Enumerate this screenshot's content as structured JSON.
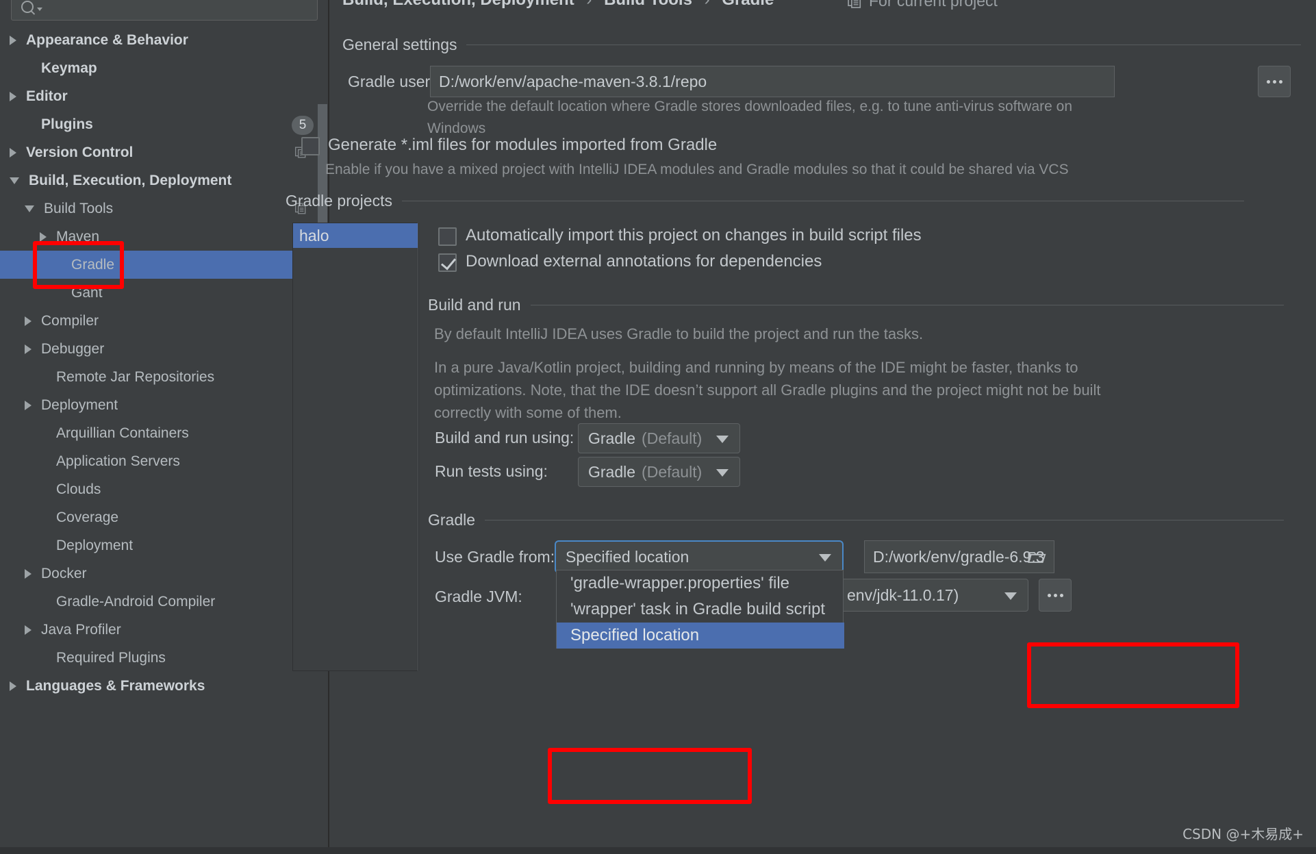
{
  "sidebar": {
    "search": {
      "placeholder": "",
      "icon": "search-icon"
    },
    "items": [
      {
        "label": "Appearance & Behavior",
        "arrow": "right",
        "bold": true,
        "indent": 0,
        "copy": false,
        "badge": null,
        "selected": false
      },
      {
        "label": "Keymap",
        "arrow": "none",
        "bold": true,
        "indent": 1,
        "copy": false,
        "badge": null,
        "selected": false
      },
      {
        "label": "Editor",
        "arrow": "right",
        "bold": true,
        "indent": 0,
        "copy": false,
        "badge": null,
        "selected": false
      },
      {
        "label": "Plugins",
        "arrow": "none",
        "bold": true,
        "indent": 1,
        "copy": false,
        "badge": "5",
        "selected": false
      },
      {
        "label": "Version Control",
        "arrow": "right",
        "bold": true,
        "indent": 0,
        "copy": true,
        "badge": null,
        "selected": false
      },
      {
        "label": "Build, Execution, Deployment",
        "arrow": "down",
        "bold": true,
        "indent": 0,
        "copy": false,
        "badge": null,
        "selected": false
      },
      {
        "label": "Build Tools",
        "arrow": "down",
        "bold": false,
        "indent": 1,
        "copy": true,
        "badge": null,
        "selected": false
      },
      {
        "label": "Maven",
        "arrow": "right",
        "bold": false,
        "indent": 2,
        "copy": true,
        "badge": null,
        "selected": false
      },
      {
        "label": "Gradle",
        "arrow": "none",
        "bold": false,
        "indent": 3,
        "copy": true,
        "badge": null,
        "selected": true
      },
      {
        "label": "Gant",
        "arrow": "none",
        "bold": false,
        "indent": 3,
        "copy": true,
        "badge": null,
        "selected": false
      },
      {
        "label": "Compiler",
        "arrow": "right",
        "bold": false,
        "indent": 1,
        "copy": true,
        "badge": null,
        "selected": false
      },
      {
        "label": "Debugger",
        "arrow": "right",
        "bold": false,
        "indent": 1,
        "copy": false,
        "badge": null,
        "selected": false
      },
      {
        "label": "Remote Jar Repositories",
        "arrow": "none",
        "bold": false,
        "indent": 2,
        "copy": true,
        "badge": null,
        "selected": false
      },
      {
        "label": "Deployment",
        "arrow": "right",
        "bold": false,
        "indent": 1,
        "copy": true,
        "badge": null,
        "selected": false
      },
      {
        "label": "Arquillian Containers",
        "arrow": "none",
        "bold": false,
        "indent": 2,
        "copy": true,
        "badge": null,
        "selected": false
      },
      {
        "label": "Application Servers",
        "arrow": "none",
        "bold": false,
        "indent": 2,
        "copy": false,
        "badge": null,
        "selected": false
      },
      {
        "label": "Clouds",
        "arrow": "none",
        "bold": false,
        "indent": 2,
        "copy": false,
        "badge": null,
        "selected": false
      },
      {
        "label": "Coverage",
        "arrow": "none",
        "bold": false,
        "indent": 2,
        "copy": true,
        "badge": null,
        "selected": false
      },
      {
        "label": "Deployment",
        "arrow": "none",
        "bold": false,
        "indent": 2,
        "copy": false,
        "badge": null,
        "selected": false
      },
      {
        "label": "Docker",
        "arrow": "right",
        "bold": false,
        "indent": 1,
        "copy": false,
        "badge": null,
        "selected": false
      },
      {
        "label": "Gradle-Android Compiler",
        "arrow": "none",
        "bold": false,
        "indent": 2,
        "copy": true,
        "badge": null,
        "selected": false
      },
      {
        "label": "Java Profiler",
        "arrow": "right",
        "bold": false,
        "indent": 1,
        "copy": false,
        "badge": null,
        "selected": false
      },
      {
        "label": "Required Plugins",
        "arrow": "none",
        "bold": false,
        "indent": 2,
        "copy": true,
        "badge": null,
        "selected": false
      },
      {
        "label": "Languages & Frameworks",
        "arrow": "right",
        "bold": true,
        "indent": 0,
        "copy": false,
        "badge": null,
        "selected": false
      }
    ]
  },
  "breadcrumb": {
    "parts": [
      "Build, Execution, Deployment",
      "Build Tools",
      "Gradle"
    ],
    "separator": "›",
    "scope_label": "For current project",
    "scope_icon": "copy-icon"
  },
  "general_settings": {
    "title": "General settings",
    "gradle_user_home_label": "Gradle user home:",
    "gradle_user_home_value": "D:/work/env/apache-maven-3.8.1/repo",
    "gradle_user_home_placeholder": "",
    "browse_button_label": "...",
    "hint_line_1": "Override the default location where Gradle stores downloaded files, e.g. to tune anti-virus software on",
    "hint_line_2": "Windows",
    "generate_iml_label": "Generate *.iml files for modules imported from Gradle",
    "generate_iml_checked": false,
    "generate_iml_hint": "Enable if you have a mixed project with IntelliJ IDEA modules and Gradle modules so that it could be shared via VCS"
  },
  "gradle_projects": {
    "title": "Gradle projects",
    "project_list": [
      "halo"
    ],
    "selected_project": "halo",
    "auto_import_label": "Automatically import this project on changes in build script files",
    "auto_import_checked": false,
    "download_annotations_label": "Download external annotations for dependencies",
    "download_annotations_checked": true
  },
  "build_and_run": {
    "title": "Build and run",
    "para1": "By default IntelliJ IDEA uses Gradle to build the project and run the tasks.",
    "para2_line1": "In a pure Java/Kotlin project, building and running by means of the IDE might be faster, thanks to",
    "para2_line2": "optimizations. Note, that the IDE doesn’t support all Gradle plugins and the project might not be built",
    "para2_line3": "correctly with some of them.",
    "build_run_using_label": "Build and run using:",
    "build_run_using_value": "Gradle",
    "build_run_using_suffix": "(Default)",
    "run_tests_using_label": "Run tests using:",
    "run_tests_using_value": "Gradle",
    "run_tests_using_suffix": "(Default)"
  },
  "gradle_section": {
    "title": "Gradle",
    "use_gradle_from_label": "Use Gradle from:",
    "use_gradle_from_value": "Specified location",
    "gradle_home_value": "D:/work/env/gradle-6.9.3",
    "gradle_home_icon": "folder-icon",
    "gradle_jvm_label": "Gradle JVM:",
    "gradle_jvm_value": "env/jdk-11.0.17)",
    "gradle_jvm_browse_label": "...",
    "dropdown_options": [
      {
        "label": "'gradle-wrapper.properties' file",
        "selected": false
      },
      {
        "label": "'wrapper' task in Gradle build script",
        "selected": false
      },
      {
        "label": "Specified location",
        "selected": true
      }
    ]
  },
  "watermark": {
    "text": "CSDN @+木易成+"
  },
  "colors": {
    "background": "#3c3f41",
    "selection_blue": "#4b6eaf",
    "focus_blue": "#4a88c7",
    "annotation_red": "#ff0000",
    "text": "#bbbbbb",
    "muted_text": "#8e9295"
  }
}
